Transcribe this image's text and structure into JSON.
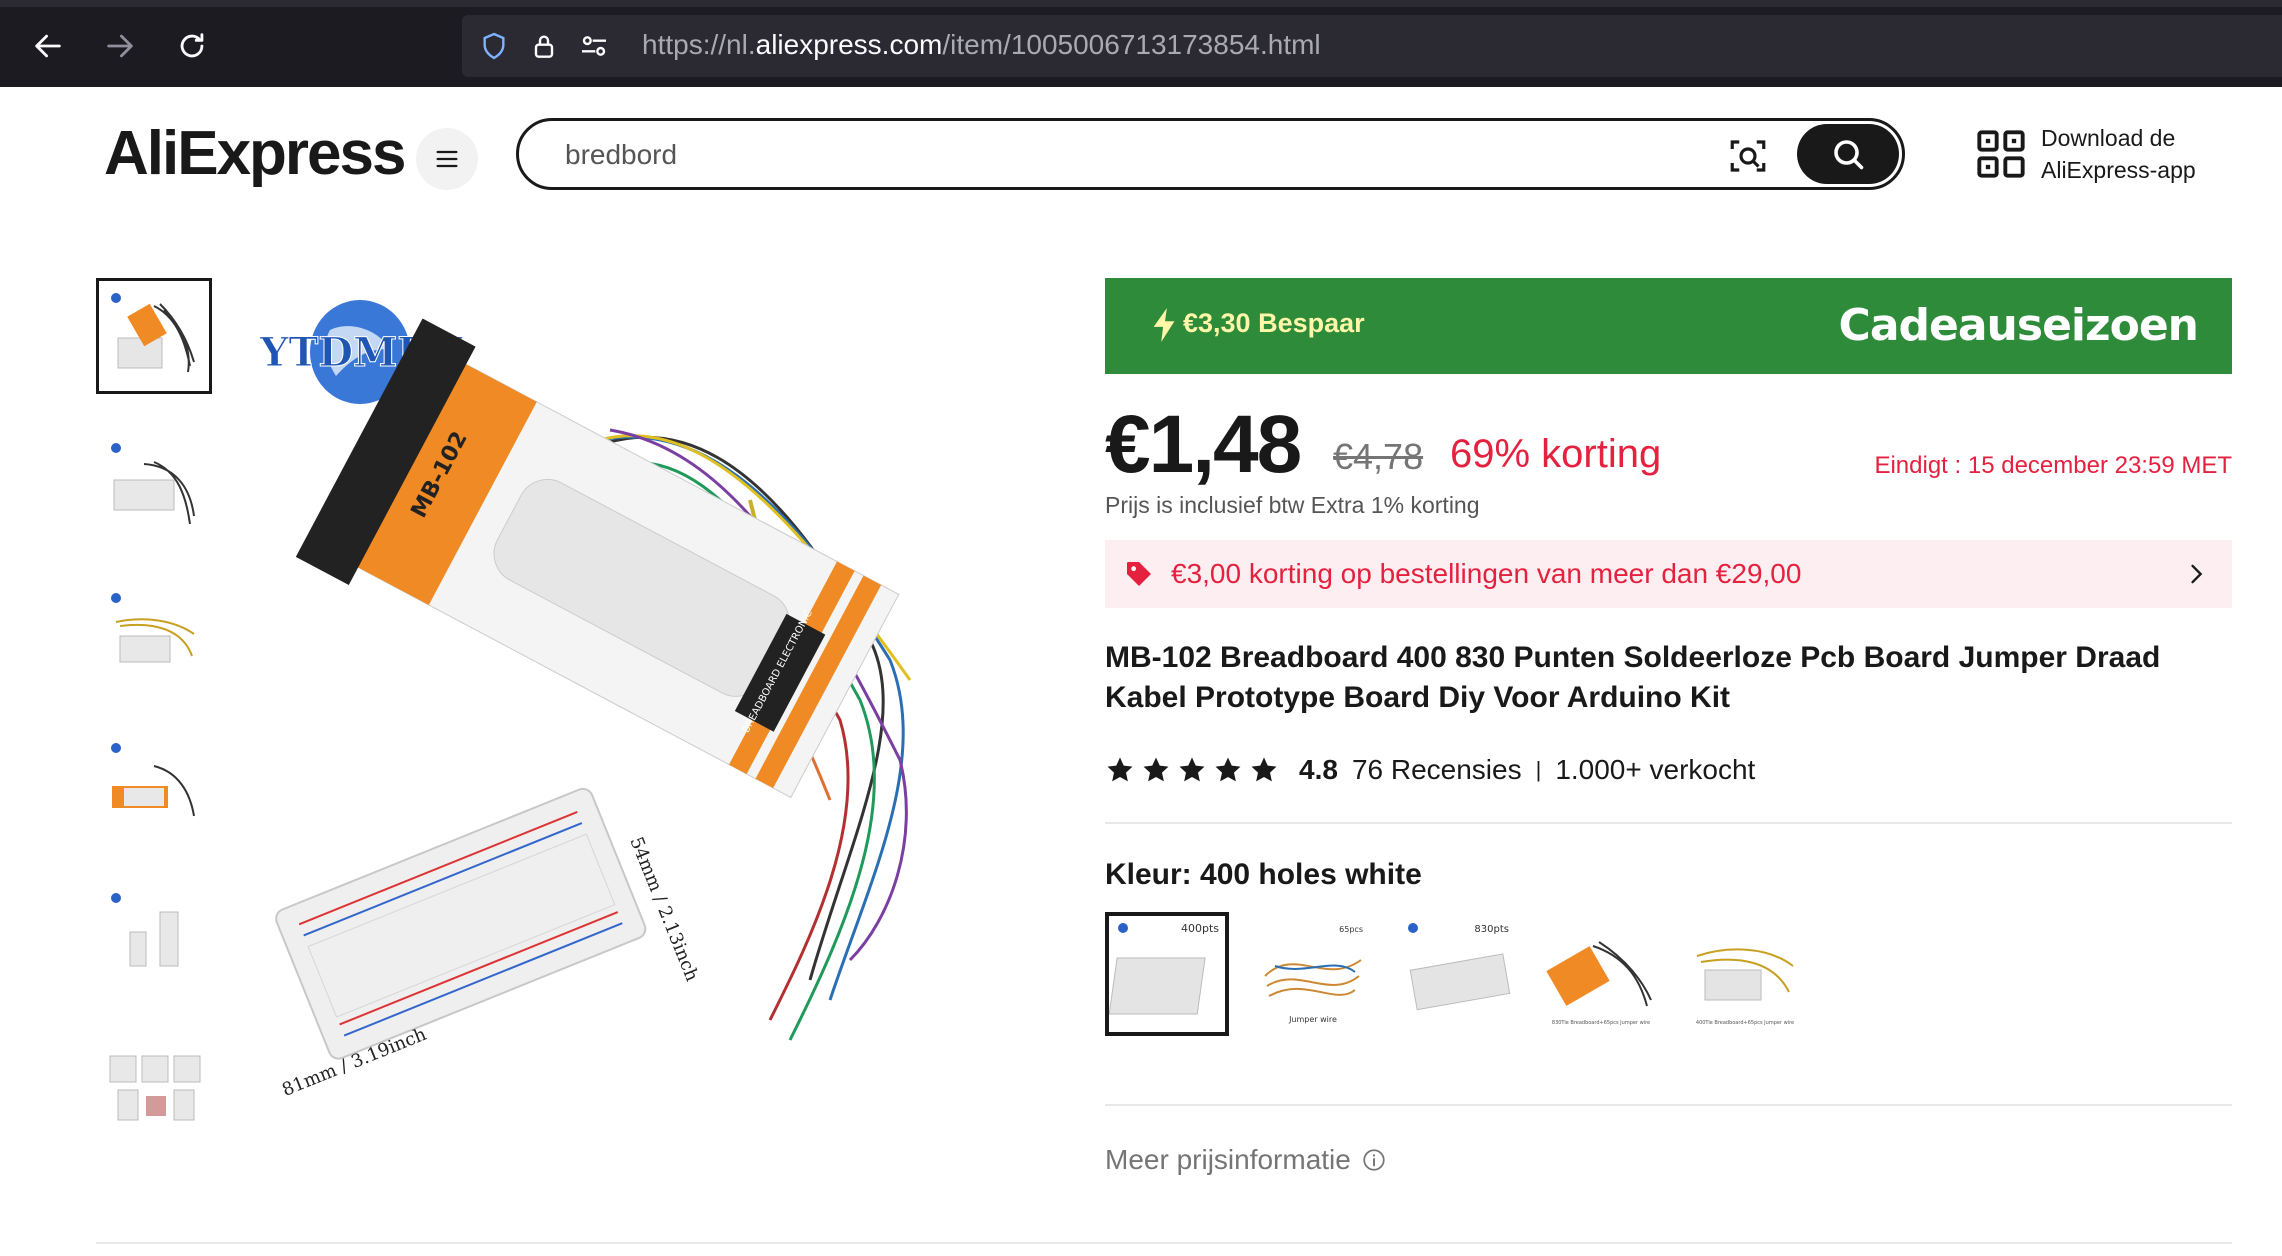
{
  "browser": {
    "url_prefix": "https://nl.",
    "url_domain": "aliexpress.com",
    "url_path": "/item/1005006713173854.html"
  },
  "header": {
    "logo_text": "AliExpress",
    "search_value": "bredbord",
    "app_download_line1": "Download de",
    "app_download_line2": "AliExpress-app"
  },
  "gallery": {
    "brand_mark": "YTDMEN",
    "board_label": "MB-102",
    "box_label": "BREADBOARD ELECTRONIC",
    "dim_width": "81mm / 3.19inch",
    "dim_height": "54mm / 2.13inch",
    "thumbnail_count": 6
  },
  "promo": {
    "savings": "€3,30 Bespaar",
    "campaign": "Cadeauseizoen",
    "banner_color": "#2e8b3a"
  },
  "price": {
    "current": "€1,48",
    "original": "€4,78",
    "discount": "69% korting",
    "ends_label": "Eindigt :",
    "ends_time": "15 december 23:59 MET",
    "vat_note": "Prijs is inclusief btw Extra 1% korting"
  },
  "coupon": {
    "text": "€3,00 korting op bestellingen van meer dan €29,00"
  },
  "product": {
    "title_line1": "MB-102 Breadboard 400 830 Punten Soldeerloze Pcb Board Jumper Draad",
    "title_line2": "Kabel Prototype Board Diy Voor Arduino Kit",
    "rating": "4.8",
    "reviews": "76 Recensies",
    "sold": "1.000+ verkocht",
    "stars": 5
  },
  "variant": {
    "label": "Kleur: 400 holes white",
    "options": [
      {
        "name": "400 holes white",
        "caption": "400pts"
      },
      {
        "name": "65 jumper wires",
        "caption": "65pcs",
        "sub": "Jumper wire"
      },
      {
        "name": "830 holes white",
        "caption": "830pts"
      },
      {
        "name": "830 breadboard + 65 wires",
        "caption": ""
      },
      {
        "name": "400 breadboard + 65 wires",
        "caption": ""
      }
    ]
  },
  "footer_links": {
    "more_price_info": "Meer prijsinformatie"
  },
  "colors": {
    "accent_red": "#e4213e",
    "text_dark": "#191919"
  }
}
